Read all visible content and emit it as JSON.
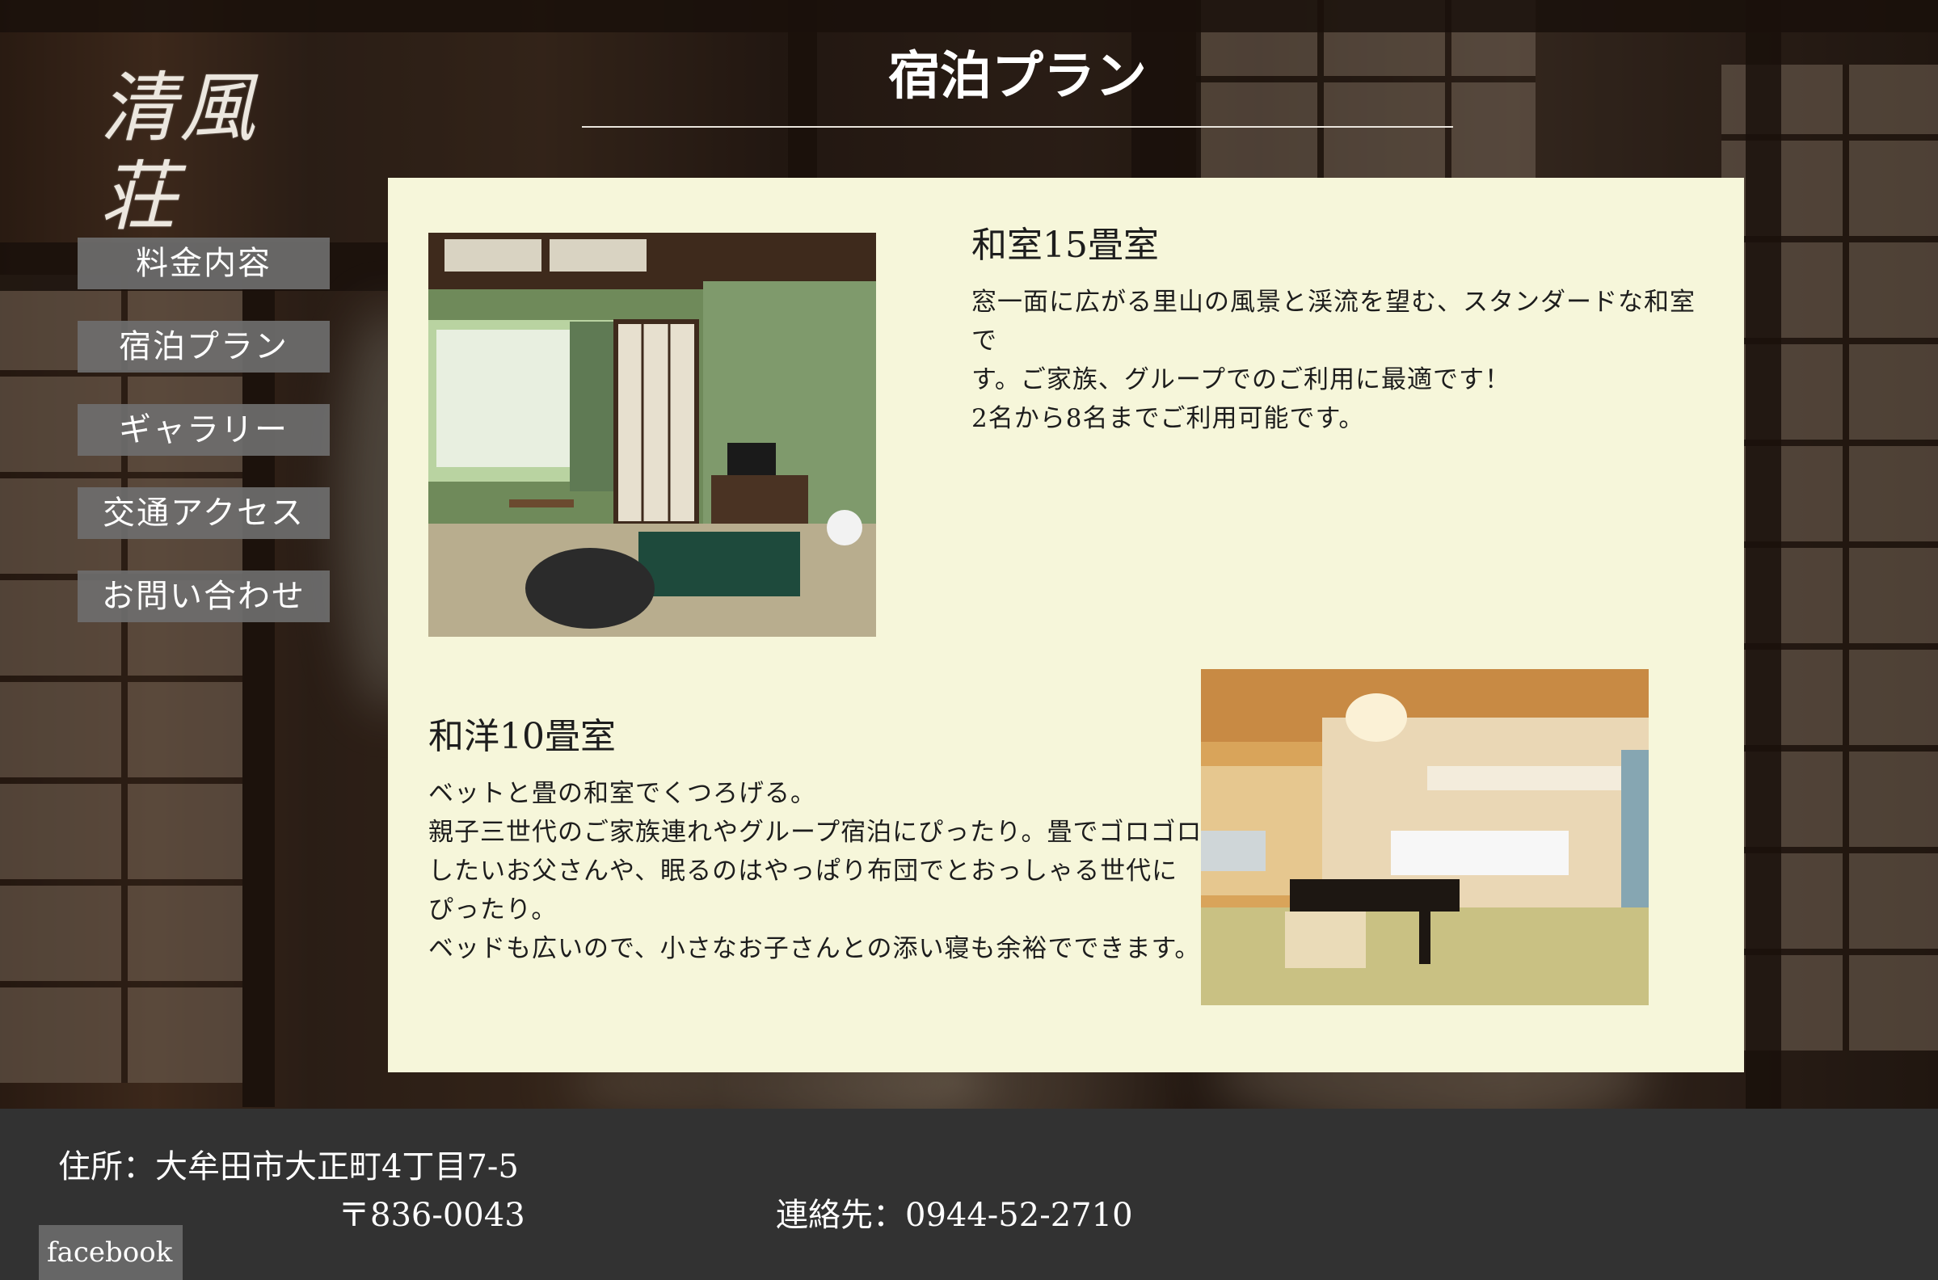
{
  "site": {
    "logo_text": "清風荘"
  },
  "page": {
    "title": "宿泊プラン"
  },
  "nav": {
    "items": [
      {
        "label": "料金内容"
      },
      {
        "label": "宿泊プラン"
      },
      {
        "label": "ギャラリー"
      },
      {
        "label": "交通アクセス"
      },
      {
        "label": "お問い合わせ"
      }
    ]
  },
  "rooms": [
    {
      "title": "和室15畳室",
      "description": "窓一面に広がる里山の風景と渓流を望む、スタンダードな和室で\nす。ご家族、グループでのご利用に最適です！\n2名から8名までご利用可能です。"
    },
    {
      "title": "和洋10畳室",
      "description": "ベットと畳の和室でくつろげる。\n親子三世代のご家族連れやグループ宿泊にぴったり。畳でゴロゴロ\nしたいお父さんや、眠るのはやっぱり布団でとおっしゃる世代に\nぴったり。\nベッドも広いので、小さなお子さんとの添い寝も余裕でできます。"
    }
  ],
  "footer": {
    "address": "住所：大牟田市大正町4丁目7-5",
    "postal": "〒836-0043",
    "contact": "連絡先：0944-52-2710",
    "facebook_label": "facebook"
  }
}
